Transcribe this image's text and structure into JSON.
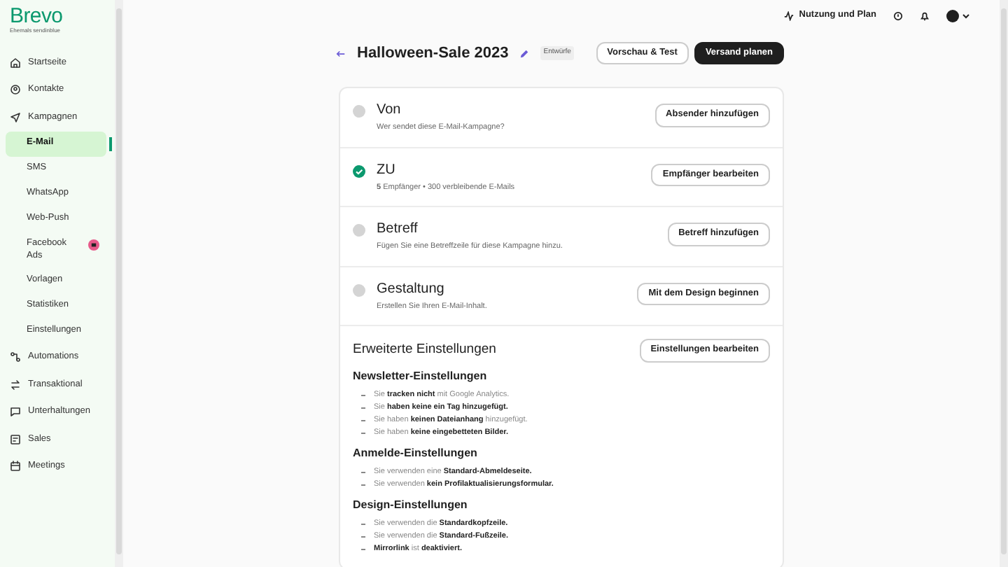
{
  "sidebar": {
    "logo": "Brevo",
    "tagline": "Ehemals sendinblue",
    "items": [
      {
        "label": "Startseite",
        "selected": false
      },
      {
        "label": "Kontakte",
        "selected": false
      },
      {
        "label": "Kampagnen",
        "selected": false,
        "children": [
          {
            "label": "E-Mail",
            "selected": true
          },
          {
            "label": "SMS",
            "selected": false
          },
          {
            "label": "WhatsApp",
            "selected": false
          },
          {
            "label": "Web-Push",
            "selected": false
          },
          {
            "label": "Facebook Ads",
            "selected": false,
            "badge": true
          },
          {
            "label": "Vorlagen",
            "selected": false
          },
          {
            "label": "Statistiken",
            "selected": false
          },
          {
            "label": "Einstellungen",
            "selected": false
          }
        ]
      },
      {
        "label": "Automations",
        "selected": false
      },
      {
        "label": "Transaktional",
        "selected": false
      },
      {
        "label": "Unterhaltungen",
        "selected": false
      },
      {
        "label": "Sales",
        "selected": false
      },
      {
        "label": "Meetings",
        "selected": false
      }
    ]
  },
  "topbar": {
    "plan_link": "Nutzung und Plan"
  },
  "campaign": {
    "title": "Halloween-Sale 2023",
    "status": "Entwürfe",
    "buttons": [
      {
        "label": "Vorschau & Test",
        "kind": "outline"
      },
      {
        "label": "Versand planen",
        "kind": "dark"
      }
    ]
  },
  "steps": [
    {
      "title": "Von",
      "subtitle": "Wer sendet diese E-Mail-Kampagne?",
      "done": false,
      "button": "Absender hinzufügen"
    },
    {
      "title": "ZU",
      "subtitle": "**5** Empfänger • 300 verbleibende E-Mails",
      "done": true,
      "button": "Empfänger bearbeiten"
    },
    {
      "title": "Betreff",
      "subtitle": "Fügen Sie eine Betreffzeile für diese Kampagne hinzu.",
      "done": false,
      "button": "Betreff hinzufügen"
    },
    {
      "title": "Gestaltung",
      "subtitle": "Erstellen Sie Ihren E-Mail-Inhalt.",
      "done": false,
      "button": "Mit dem Design beginnen"
    }
  ],
  "advanced": {
    "title": "Erweiterte Einstellungen",
    "button": "Einstellungen bearbeiten",
    "sections": [
      {
        "title": "Newsletter-Einstellungen",
        "items": [
          "Sie **tracken nicht** mit Google Analytics.",
          "Sie **haben keine ein Tag hinzugefügt.**",
          "Sie haben **keinen Dateianhang** hinzugefügt.",
          "Sie haben **keine eingebetteten Bilder.**"
        ]
      },
      {
        "title": "Anmelde-Einstellungen",
        "items": [
          "Sie verwenden eine **Standard-Abmeldeseite.**",
          "Sie verwenden **kein Profilaktualisierungsformular.**"
        ]
      },
      {
        "title": "Design-Einstellungen",
        "items": [
          "Sie verwenden die **Standardkopfzeile.**",
          "Sie verwenden die **Standard-Fußzeile.**",
          "**Mirrorlink** ist **deaktiviert.**"
        ]
      }
    ]
  }
}
